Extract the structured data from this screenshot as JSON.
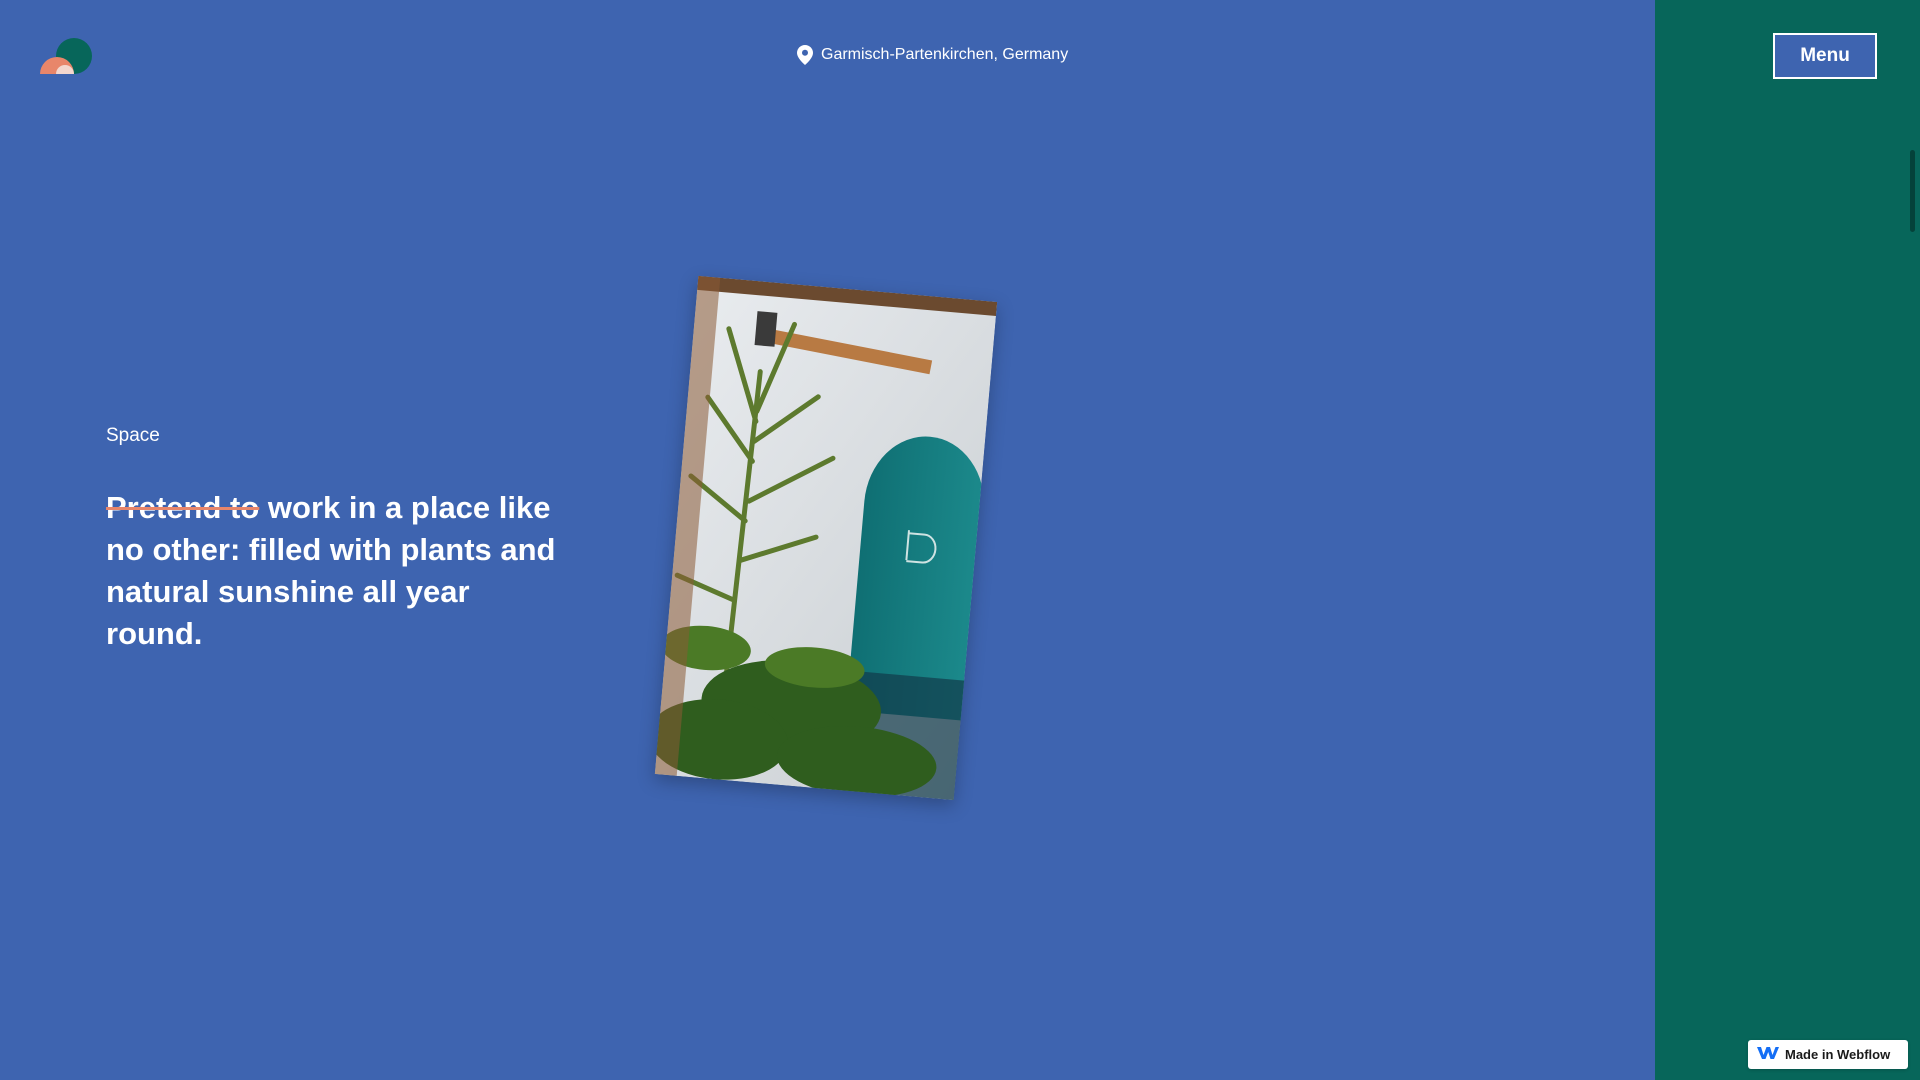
{
  "header": {
    "location": "Garmisch-Partenkirchen, Germany",
    "menu_label": "Menu"
  },
  "content": {
    "section_label": "Space",
    "headline_struck": "Pretend to",
    "headline_rest": " work in a place like no other: filled with plants and natural sunshine all year round."
  },
  "badge": {
    "label": "Made in Webflow"
  },
  "colors": {
    "main_background": "#3E64B0",
    "side_panel": "#07665A",
    "strike_accent": "#E8866A",
    "logo_dark_circle": "#07665A",
    "logo_salmon": "#E8866A"
  },
  "icons": {
    "logo": "brand-logo-icon",
    "location": "map-pin-icon",
    "webflow": "webflow-logo-icon"
  }
}
